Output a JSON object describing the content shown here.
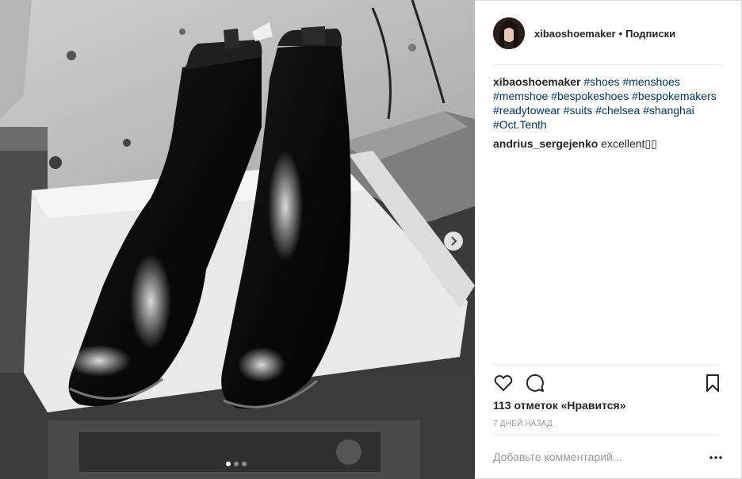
{
  "post": {
    "username": "xibaoshoemaker",
    "separator": "•",
    "follow_label": "Подписки",
    "caption": {
      "username": "xibaoshoemaker",
      "hashtags": [
        "#shoes",
        "#menshoes",
        "#memshoe",
        "#bespokeshoes",
        "#bespokemakers",
        "#readytowear",
        "#suits",
        "#chelsea",
        "#shanghai",
        "#Oct.Tenth"
      ]
    },
    "comment": {
      "username": "andrius_sergejenko",
      "text": "excellent▯▯"
    },
    "likes": "113 отметок «Нравится»",
    "time": "7 ДНЕЙ НАЗАД",
    "add_comment_placeholder": "Добавьте комментарий..."
  },
  "carousel": {
    "slide_count": 3,
    "active_index": 0
  },
  "icons": {
    "next": "chevron-right-icon",
    "like": "heart-icon",
    "comment": "speech-bubble-icon",
    "save": "bookmark-icon",
    "more": "ellipsis-icon"
  },
  "colors": {
    "hashtag": "#003569",
    "text": "#262626",
    "muted": "#999999",
    "border": "#dbdbdb"
  }
}
